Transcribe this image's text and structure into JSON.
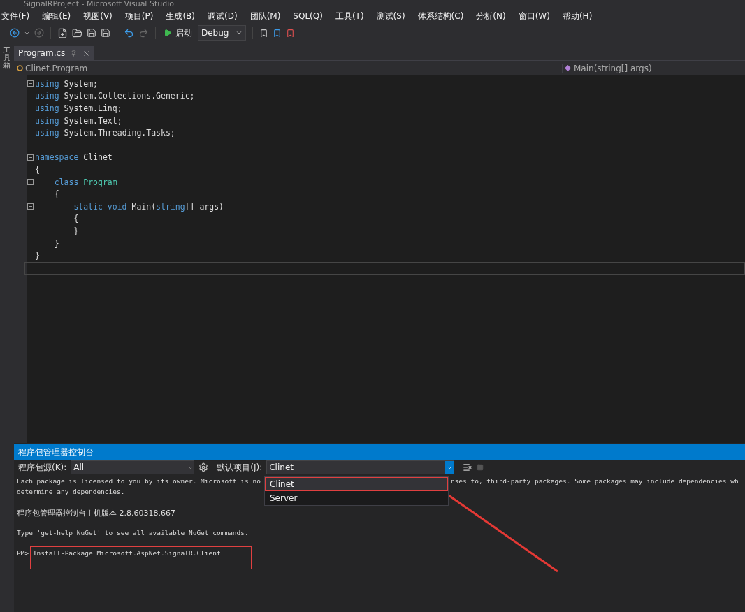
{
  "window": {
    "title": "SignalRProject - Microsoft Visual Studio"
  },
  "menu": [
    "文件(F)",
    "编辑(E)",
    "视图(V)",
    "项目(P)",
    "生成(B)",
    "调试(D)",
    "团队(M)",
    "SQL(Q)",
    "工具(T)",
    "测试(S)",
    "体系结构(C)",
    "分析(N)",
    "窗口(W)",
    "帮助(H)"
  ],
  "toolbar": {
    "start_label": "启动",
    "configuration": "Debug"
  },
  "side_strip": {
    "label": "工具箱"
  },
  "tabs": [
    {
      "label": "Program.cs",
      "selected": true
    }
  ],
  "nav": {
    "type_scope": "Clinet.Program",
    "member": "Main(string[] args)"
  },
  "code": [
    {
      "fold": true,
      "current": false,
      "tokens": [
        {
          "kind": "keyword",
          "text": "using"
        },
        {
          "kind": "plain",
          "text": " System;"
        }
      ]
    },
    {
      "fold": false,
      "current": false,
      "tokens": [
        {
          "kind": "keyword",
          "text": "using"
        },
        {
          "kind": "plain",
          "text": " System.Collections.Generic;"
        }
      ]
    },
    {
      "fold": false,
      "current": false,
      "tokens": [
        {
          "kind": "keyword",
          "text": "using"
        },
        {
          "kind": "plain",
          "text": " System.Linq;"
        }
      ]
    },
    {
      "fold": false,
      "current": false,
      "tokens": [
        {
          "kind": "keyword",
          "text": "using"
        },
        {
          "kind": "plain",
          "text": " System.Text;"
        }
      ]
    },
    {
      "fold": false,
      "current": false,
      "tokens": [
        {
          "kind": "keyword",
          "text": "using"
        },
        {
          "kind": "plain",
          "text": " System.Threading.Tasks;"
        }
      ]
    },
    {
      "fold": false,
      "current": false
    },
    {
      "fold": true,
      "current": false,
      "tokens": [
        {
          "kind": "keyword",
          "text": "namespace"
        },
        {
          "kind": "plain",
          "text": " Clinet"
        }
      ]
    },
    {
      "fold": false,
      "current": false,
      "tokens": [
        {
          "kind": "plain",
          "text": "{"
        }
      ]
    },
    {
      "fold": true,
      "current": false,
      "tokens": [
        {
          "kind": "keyword",
          "text": "    class"
        },
        {
          "kind": "type",
          "text": " Program"
        }
      ]
    },
    {
      "fold": false,
      "current": false,
      "tokens": [
        {
          "kind": "plain",
          "text": "    {"
        }
      ]
    },
    {
      "fold": true,
      "current": false,
      "tokens": [
        {
          "kind": "keyword",
          "text": "        static void"
        },
        {
          "kind": "plain",
          "text": " Main("
        },
        {
          "kind": "keyword",
          "text": "string"
        },
        {
          "kind": "plain",
          "text": "[] args)"
        }
      ]
    },
    {
      "fold": false,
      "current": false,
      "tokens": [
        {
          "kind": "plain",
          "text": "        {"
        }
      ]
    },
    {
      "fold": false,
      "current": false,
      "tokens": [
        {
          "kind": "plain",
          "text": "        }"
        }
      ]
    },
    {
      "fold": false,
      "current": false,
      "tokens": [
        {
          "kind": "plain",
          "text": "    }"
        }
      ]
    },
    {
      "fold": false,
      "current": false,
      "tokens": [
        {
          "kind": "plain",
          "text": "}"
        }
      ]
    },
    {
      "fold": false,
      "current": true
    }
  ],
  "console": {
    "title": "程序包管理器控制台",
    "source_label": "程序包源(K):",
    "source_value": "All",
    "project_label": "默认项目(J):",
    "project_value": "Clinet",
    "project_options": [
      {
        "label": "Clinet",
        "selected": true
      },
      {
        "label": "Server",
        "selected": false
      }
    ],
    "license_left": "Each package is licensed to you by its owner. Microsoft is no",
    "license_right": "nses to, third-party packages. Some packages may include dependencies wh",
    "license_line2": "determine any dependencies.",
    "version": "程序包管理器控制台主机版本 2.8.60318.667",
    "help": "Type 'get-help NuGet' to see all available NuGet commands.",
    "prompt": "PM>",
    "command": "Install-Package Microsoft.AspNet.SignalR.Client"
  }
}
